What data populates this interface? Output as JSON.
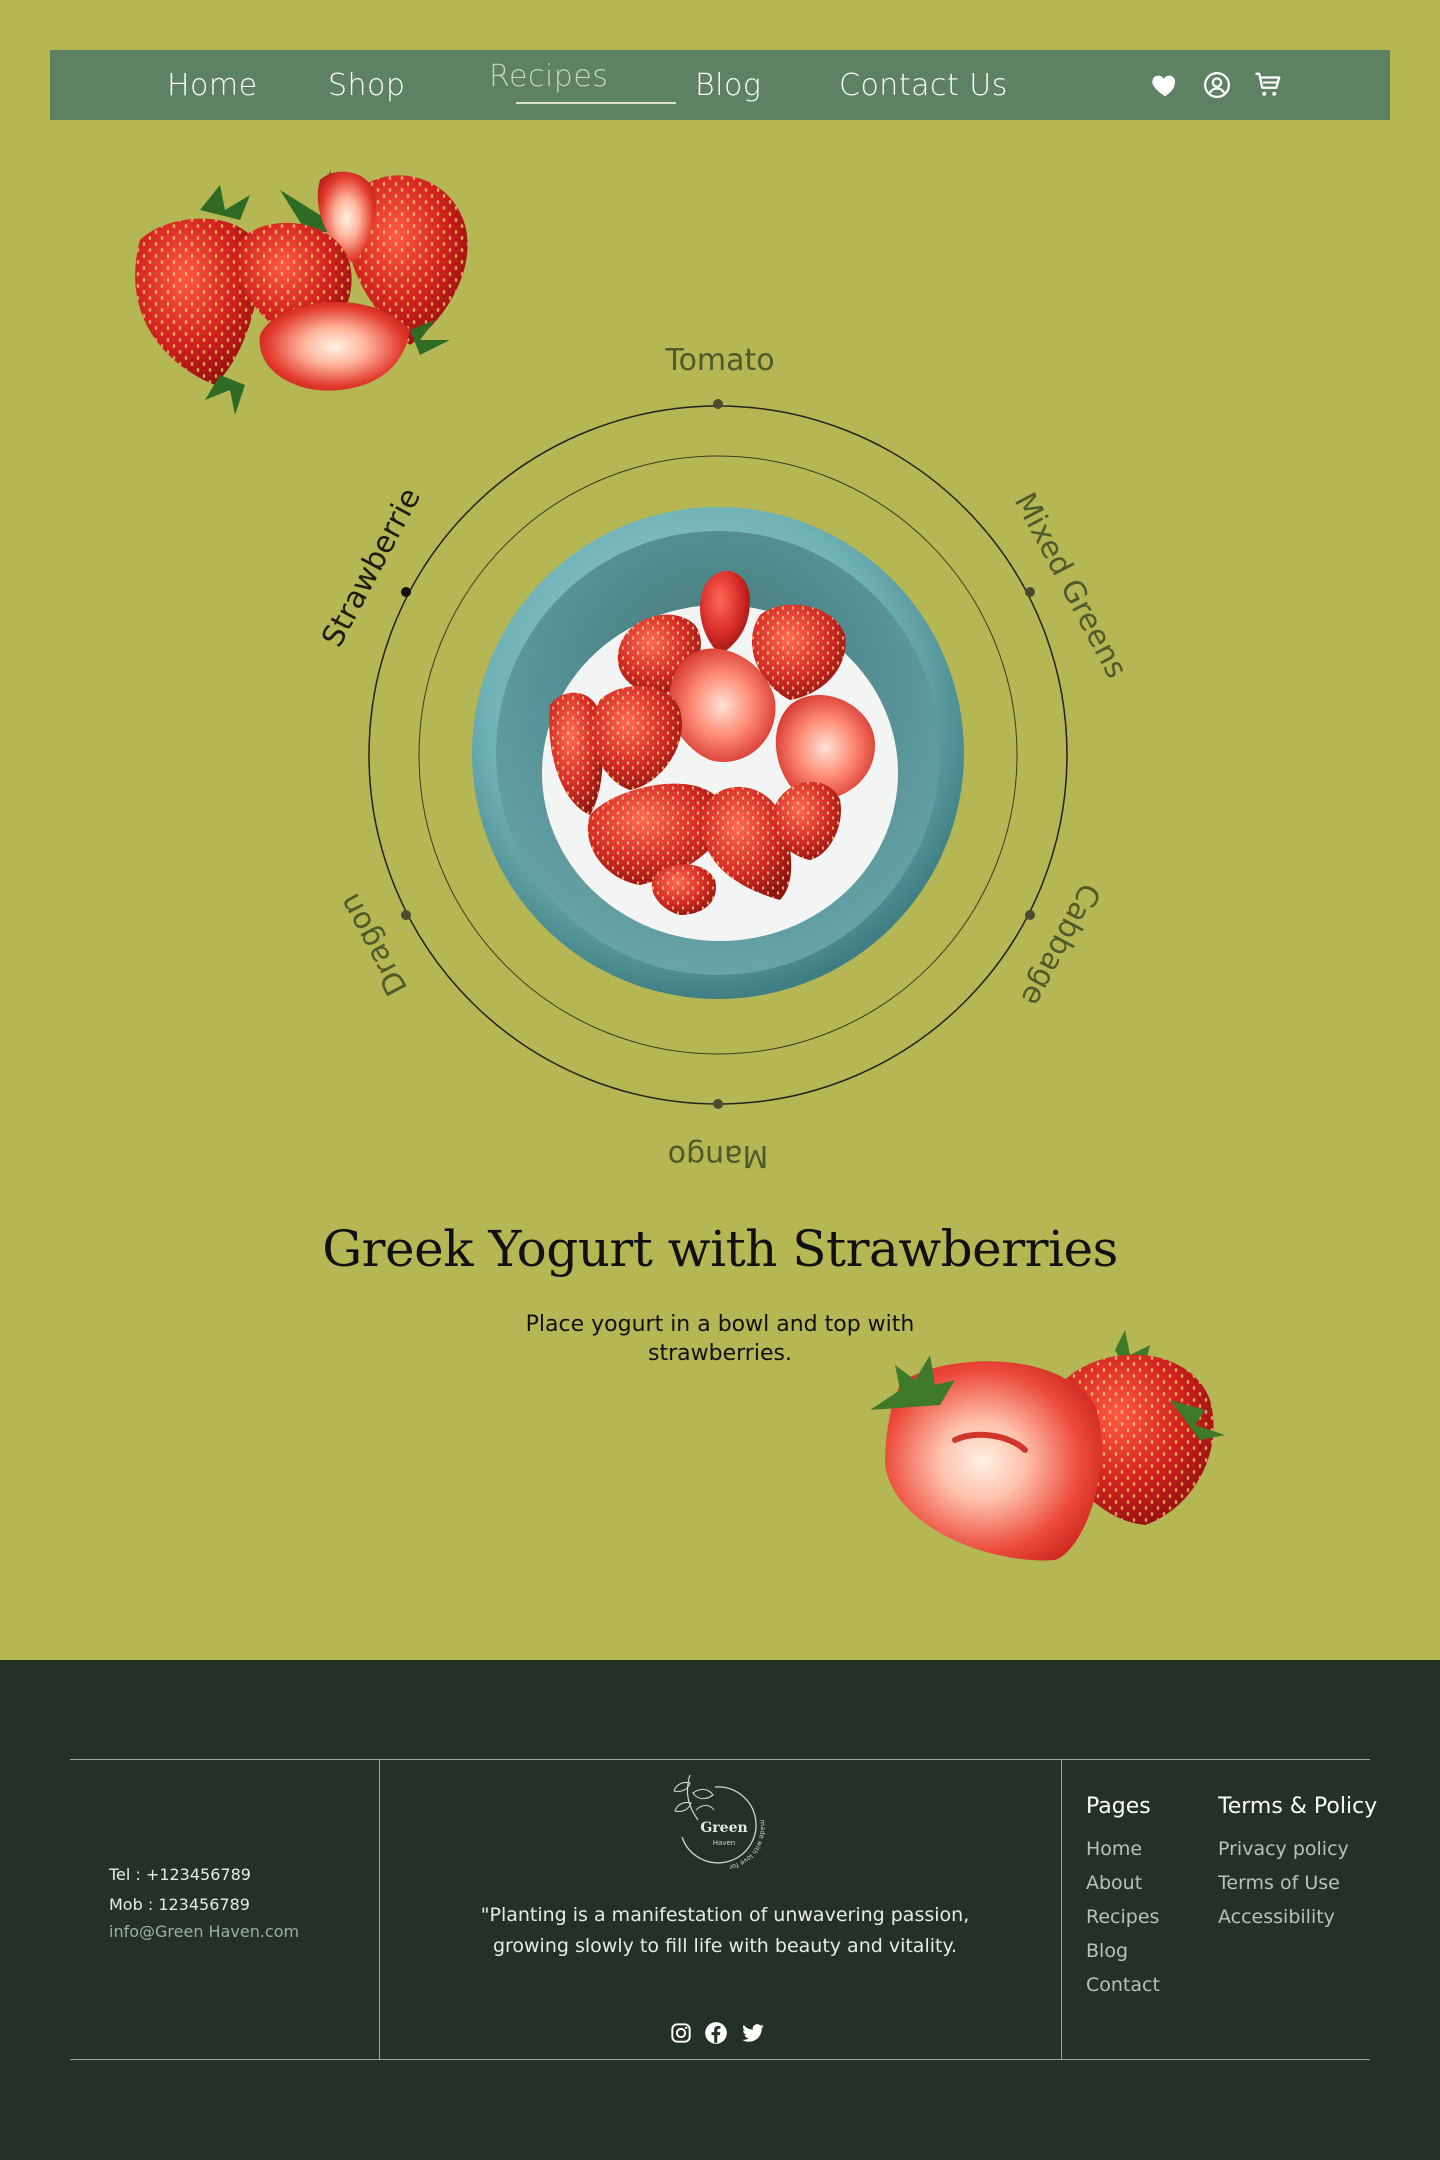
{
  "nav": {
    "items": [
      {
        "label": "Home"
      },
      {
        "label": "Shop"
      },
      {
        "label": "Recipes",
        "active": true
      },
      {
        "label": "Blog"
      },
      {
        "label": "Contact Us"
      }
    ],
    "icons": [
      "heart-icon",
      "user-icon",
      "cart-icon"
    ]
  },
  "ring": {
    "labels": [
      "Tomato",
      "Mixed Greens",
      "Cabbage",
      "Mango",
      "Dragon",
      "Strawberrie"
    ],
    "active": "Strawberrie"
  },
  "recipe": {
    "title": "Greek Yogurt with Strawberries",
    "description": "Place yogurt in a bowl and top with strawberries."
  },
  "footer": {
    "tel": "Tel : +123456789",
    "mob": "Mob : 123456789",
    "email": "info@Green Haven.com",
    "logo_text": "Green",
    "logo_sub": "Haven",
    "logo_tagline": "made with love for you",
    "quote": "\"Planting is a manifestation of unwavering passion, growing slowly to fill life with beauty and vitality.",
    "pages": {
      "heading": "Pages",
      "items": [
        "Home",
        "About",
        "Recipes",
        "Blog",
        "Contact"
      ]
    },
    "terms": {
      "heading": "Terms & Policy",
      "items": [
        "Privacy policy",
        "Terms of Use",
        "Accessibility"
      ]
    },
    "social_icons": [
      "instagram-icon",
      "facebook-icon",
      "twitter-icon"
    ]
  },
  "colors": {
    "background": "#b5b754",
    "nav": "#5e8163",
    "footer": "#243127",
    "strawberry": "#d42a26",
    "bowl": "#7fbcbf"
  }
}
